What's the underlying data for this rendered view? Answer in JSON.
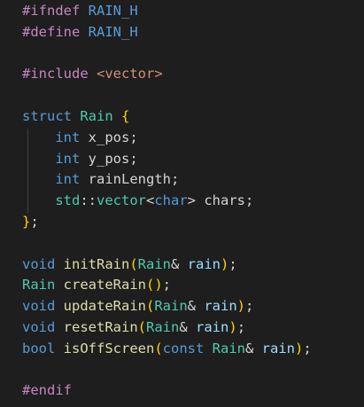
{
  "editor": {
    "language": "cpp",
    "colors": {
      "background": "#1e1e1e",
      "default": "#d4d4d4",
      "keyword": "#569cd6",
      "control": "#c586c0",
      "type": "#4ec9b0",
      "function": "#dcdcaa",
      "variable": "#9cdcfe",
      "macro": "#569cd6",
      "string": "#ce9178",
      "bracket1": "#ffd700",
      "bracket2": "#da70d6",
      "indent-guide": "#404040"
    },
    "lines": [
      {
        "tokens": [
          {
            "t": "#ifndef ",
            "c": "control"
          },
          {
            "t": "RAIN_H",
            "c": "macro"
          }
        ]
      },
      {
        "tokens": [
          {
            "t": "#define ",
            "c": "control"
          },
          {
            "t": "RAIN_H",
            "c": "macro"
          }
        ]
      },
      {
        "tokens": []
      },
      {
        "tokens": [
          {
            "t": "#include ",
            "c": "control"
          },
          {
            "t": "<vector>",
            "c": "string"
          }
        ]
      },
      {
        "tokens": []
      },
      {
        "tokens": [
          {
            "t": "struct ",
            "c": "keyword"
          },
          {
            "t": "Rain",
            "c": "type"
          },
          {
            "t": " ",
            "c": "default"
          },
          {
            "t": "{",
            "c": "bracket1"
          }
        ]
      },
      {
        "tokens": [
          {
            "t": "    ",
            "c": "default"
          },
          {
            "t": "int",
            "c": "keyword"
          },
          {
            "t": " x_pos;",
            "c": "default"
          }
        ]
      },
      {
        "tokens": [
          {
            "t": "    ",
            "c": "default"
          },
          {
            "t": "int",
            "c": "keyword"
          },
          {
            "t": " y_pos;",
            "c": "default"
          }
        ]
      },
      {
        "tokens": [
          {
            "t": "    ",
            "c": "default"
          },
          {
            "t": "int",
            "c": "keyword"
          },
          {
            "t": " rainLength;",
            "c": "default"
          }
        ]
      },
      {
        "tokens": [
          {
            "t": "    ",
            "c": "default"
          },
          {
            "t": "std",
            "c": "type"
          },
          {
            "t": "::",
            "c": "default"
          },
          {
            "t": "vector",
            "c": "type"
          },
          {
            "t": "<",
            "c": "default"
          },
          {
            "t": "char",
            "c": "keyword"
          },
          {
            "t": "> chars;",
            "c": "default"
          }
        ]
      },
      {
        "tokens": [
          {
            "t": "}",
            "c": "bracket1"
          },
          {
            "t": ";",
            "c": "default"
          }
        ]
      },
      {
        "tokens": []
      },
      {
        "tokens": [
          {
            "t": "void ",
            "c": "keyword"
          },
          {
            "t": "initRain",
            "c": "function"
          },
          {
            "t": "(",
            "c": "bracket1"
          },
          {
            "t": "Rain",
            "c": "type"
          },
          {
            "t": "& ",
            "c": "default"
          },
          {
            "t": "rain",
            "c": "variable"
          },
          {
            "t": ")",
            "c": "bracket1"
          },
          {
            "t": ";",
            "c": "default"
          }
        ]
      },
      {
        "tokens": [
          {
            "t": "Rain",
            "c": "type"
          },
          {
            "t": " ",
            "c": "default"
          },
          {
            "t": "createRain",
            "c": "function"
          },
          {
            "t": "()",
            "c": "bracket1"
          },
          {
            "t": ";",
            "c": "default"
          }
        ]
      },
      {
        "tokens": [
          {
            "t": "void ",
            "c": "keyword"
          },
          {
            "t": "updateRain",
            "c": "function"
          },
          {
            "t": "(",
            "c": "bracket1"
          },
          {
            "t": "Rain",
            "c": "type"
          },
          {
            "t": "& ",
            "c": "default"
          },
          {
            "t": "rain",
            "c": "variable"
          },
          {
            "t": ")",
            "c": "bracket1"
          },
          {
            "t": ";",
            "c": "default"
          }
        ]
      },
      {
        "tokens": [
          {
            "t": "void ",
            "c": "keyword"
          },
          {
            "t": "resetRain",
            "c": "function"
          },
          {
            "t": "(",
            "c": "bracket1"
          },
          {
            "t": "Rain",
            "c": "type"
          },
          {
            "t": "& ",
            "c": "default"
          },
          {
            "t": "rain",
            "c": "variable"
          },
          {
            "t": ")",
            "c": "bracket1"
          },
          {
            "t": ";",
            "c": "default"
          }
        ]
      },
      {
        "tokens": [
          {
            "t": "bool ",
            "c": "keyword"
          },
          {
            "t": "isOffScreen",
            "c": "function"
          },
          {
            "t": "(",
            "c": "bracket1"
          },
          {
            "t": "const ",
            "c": "keyword"
          },
          {
            "t": "Rain",
            "c": "type"
          },
          {
            "t": "& ",
            "c": "default"
          },
          {
            "t": "rain",
            "c": "variable"
          },
          {
            "t": ")",
            "c": "bracket1"
          },
          {
            "t": ";",
            "c": "default"
          }
        ]
      },
      {
        "tokens": []
      },
      {
        "tokens": [
          {
            "t": "#endif",
            "c": "control"
          }
        ]
      }
    ]
  }
}
